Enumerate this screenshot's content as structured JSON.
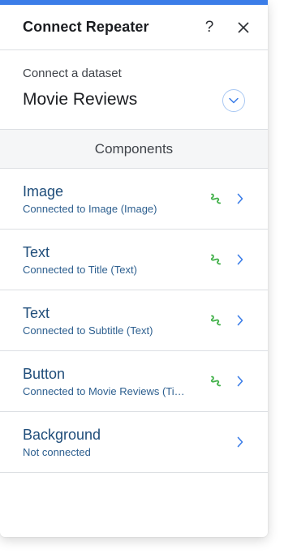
{
  "panel": {
    "title": "Connect Repeater",
    "help_symbol": "?",
    "accent_color": "#3b7de8"
  },
  "dataset": {
    "label": "Connect a dataset",
    "value": "Movie Reviews"
  },
  "components": {
    "header": "Components",
    "items": [
      {
        "title": "Image",
        "subtitle": "Connected to Image (Image)",
        "connected": true,
        "icon": "link-icon"
      },
      {
        "title": "Text",
        "subtitle": "Connected to Title (Text)",
        "connected": true,
        "icon": "link-icon"
      },
      {
        "title": "Text",
        "subtitle": "Connected to Subtitle (Text)",
        "connected": true,
        "icon": "link-icon"
      },
      {
        "title": "Button",
        "subtitle": "Connected to Movie Reviews (Ti…",
        "connected": true,
        "icon": "link-icon"
      },
      {
        "title": "Background",
        "subtitle": "Not connected",
        "connected": false
      }
    ]
  },
  "colors": {
    "connected_icon": "#43b14b",
    "chevron": "#3b7de8"
  }
}
